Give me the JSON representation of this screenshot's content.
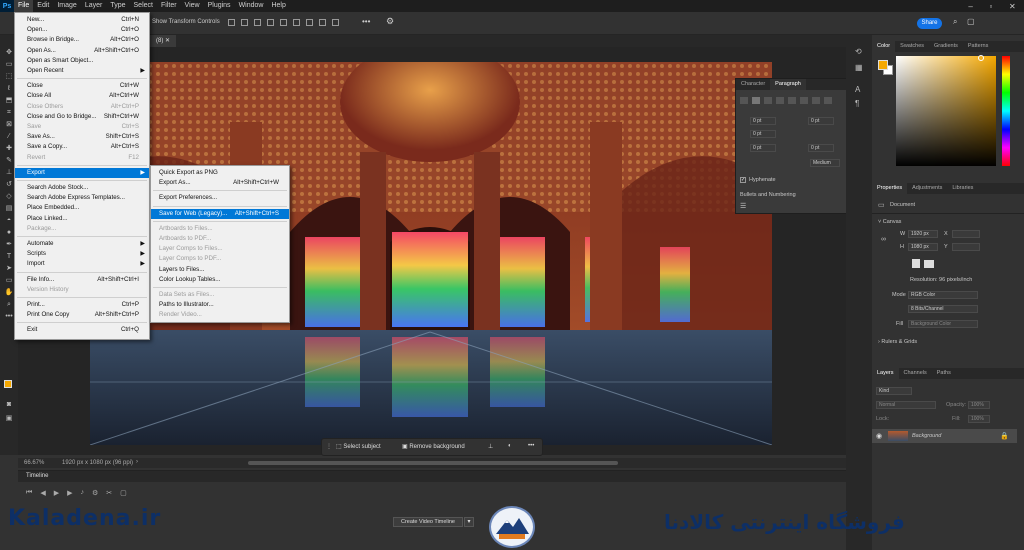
{
  "app": {
    "logo": "Ps"
  },
  "menubar": [
    "File",
    "Edit",
    "Image",
    "Layer",
    "Type",
    "Select",
    "Filter",
    "View",
    "Plugins",
    "Window",
    "Help"
  ],
  "options": {
    "transform_label": "Show Transform Controls",
    "share": "Share"
  },
  "doc_tab": "(8)",
  "file_menu": [
    {
      "label": "New...",
      "shortcut": "Ctrl+N"
    },
    {
      "label": "Open...",
      "shortcut": "Ctrl+O"
    },
    {
      "label": "Browse in Bridge...",
      "shortcut": "Alt+Ctrl+O"
    },
    {
      "label": "Open As...",
      "shortcut": "Alt+Shift+Ctrl+O"
    },
    {
      "label": "Open as Smart Object...",
      "shortcut": ""
    },
    {
      "label": "Open Recent",
      "shortcut": "",
      "submenu": true
    },
    {
      "label": "Close",
      "shortcut": "Ctrl+W"
    },
    {
      "label": "Close All",
      "shortcut": "Alt+Ctrl+W"
    },
    {
      "label": "Close Others",
      "shortcut": "Alt+Ctrl+P",
      "disabled": true
    },
    {
      "label": "Close and Go to Bridge...",
      "shortcut": "Shift+Ctrl+W"
    },
    {
      "label": "Save",
      "shortcut": "Ctrl+S",
      "disabled": true
    },
    {
      "label": "Save As...",
      "shortcut": "Shift+Ctrl+S"
    },
    {
      "label": "Save a Copy...",
      "shortcut": "Alt+Ctrl+S"
    },
    {
      "label": "Revert",
      "shortcut": "F12",
      "disabled": true
    },
    {
      "label": "Export",
      "shortcut": "",
      "submenu": true,
      "highlight": true
    },
    {
      "label": "Search Adobe Stock...",
      "shortcut": ""
    },
    {
      "label": "Search Adobe Express Templates...",
      "shortcut": ""
    },
    {
      "label": "Place Embedded...",
      "shortcut": ""
    },
    {
      "label": "Place Linked...",
      "shortcut": ""
    },
    {
      "label": "Package...",
      "shortcut": "",
      "disabled": true
    },
    {
      "label": "Automate",
      "shortcut": "",
      "submenu": true
    },
    {
      "label": "Scripts",
      "shortcut": "",
      "submenu": true
    },
    {
      "label": "Import",
      "shortcut": "",
      "submenu": true
    },
    {
      "label": "File Info...",
      "shortcut": "Alt+Shift+Ctrl+I"
    },
    {
      "label": "Version History",
      "shortcut": "",
      "disabled": true
    },
    {
      "label": "Print...",
      "shortcut": "Ctrl+P"
    },
    {
      "label": "Print One Copy",
      "shortcut": "Alt+Shift+Ctrl+P"
    },
    {
      "label": "Exit",
      "shortcut": "Ctrl+Q"
    }
  ],
  "export_menu": [
    {
      "label": "Quick Export as PNG",
      "shortcut": ""
    },
    {
      "label": "Export As...",
      "shortcut": "Alt+Shift+Ctrl+W"
    },
    {
      "label": "Export Preferences...",
      "shortcut": ""
    },
    {
      "label": "Save for Web (Legacy)...",
      "shortcut": "Alt+Shift+Ctrl+S",
      "highlight": true
    },
    {
      "label": "Artboards to Files...",
      "shortcut": "",
      "disabled": true
    },
    {
      "label": "Artboards to PDF...",
      "shortcut": "",
      "disabled": true
    },
    {
      "label": "Layer Comps to Files...",
      "shortcut": "",
      "disabled": true
    },
    {
      "label": "Layer Comps to PDF...",
      "shortcut": "",
      "disabled": true
    },
    {
      "label": "Layers to Files...",
      "shortcut": ""
    },
    {
      "label": "Color Lookup Tables...",
      "shortcut": ""
    },
    {
      "label": "Data Sets as Files...",
      "shortcut": "",
      "disabled": true
    },
    {
      "label": "Paths to Illustrator...",
      "shortcut": ""
    },
    {
      "label": "Render Video...",
      "shortcut": "",
      "disabled": true
    }
  ],
  "status": {
    "zoom": "66.67%",
    "info": "1920 px x 1080 px (96 ppi)"
  },
  "context_bar": {
    "select_subject": "Select subject",
    "remove_bg": "Remove background"
  },
  "timeline": {
    "title": "Timeline",
    "create_btn": "Create Video Timeline"
  },
  "color_panel": {
    "tabs": [
      "Color",
      "Swatches",
      "Gradients",
      "Patterns"
    ],
    "fg": "#f5a800",
    "bg": "#ffffff"
  },
  "properties": {
    "tabs": [
      "Properties",
      "Adjustments",
      "Libraries"
    ],
    "doc_label": "Document",
    "canvas_label": "Canvas",
    "w": "1920 px",
    "h": "1080 px",
    "x_label": "X",
    "y_label": "Y",
    "w_label": "W",
    "h_label": "H",
    "resolution": "Resolution: 96 pixels/inch",
    "mode_label": "Mode",
    "mode": "RGB Color",
    "bits": "8 Bits/Channel",
    "fill_label": "Fill",
    "fill_value": "Background Color",
    "rulers": "Rulers & Grids"
  },
  "layers": {
    "tabs": [
      "Layers",
      "Channels",
      "Paths"
    ],
    "kind": "Kind",
    "blend": "Normal",
    "opacity_label": "Opacity:",
    "opacity": "100%",
    "lock_label": "Lock:",
    "fill_label": "Fill:",
    "fill": "100%",
    "layer_name": "Background"
  },
  "char_panel": {
    "tabs": [
      "Character",
      "Paragraph"
    ],
    "pt": "0 pt",
    "hyphenate": "Hyphenate",
    "bullets": "Bullets and Numbering",
    "weight": "Medium"
  },
  "watermark": {
    "left": "Kaladena.ir",
    "right": "فروشگاه اینترنتی کالادنا"
  }
}
